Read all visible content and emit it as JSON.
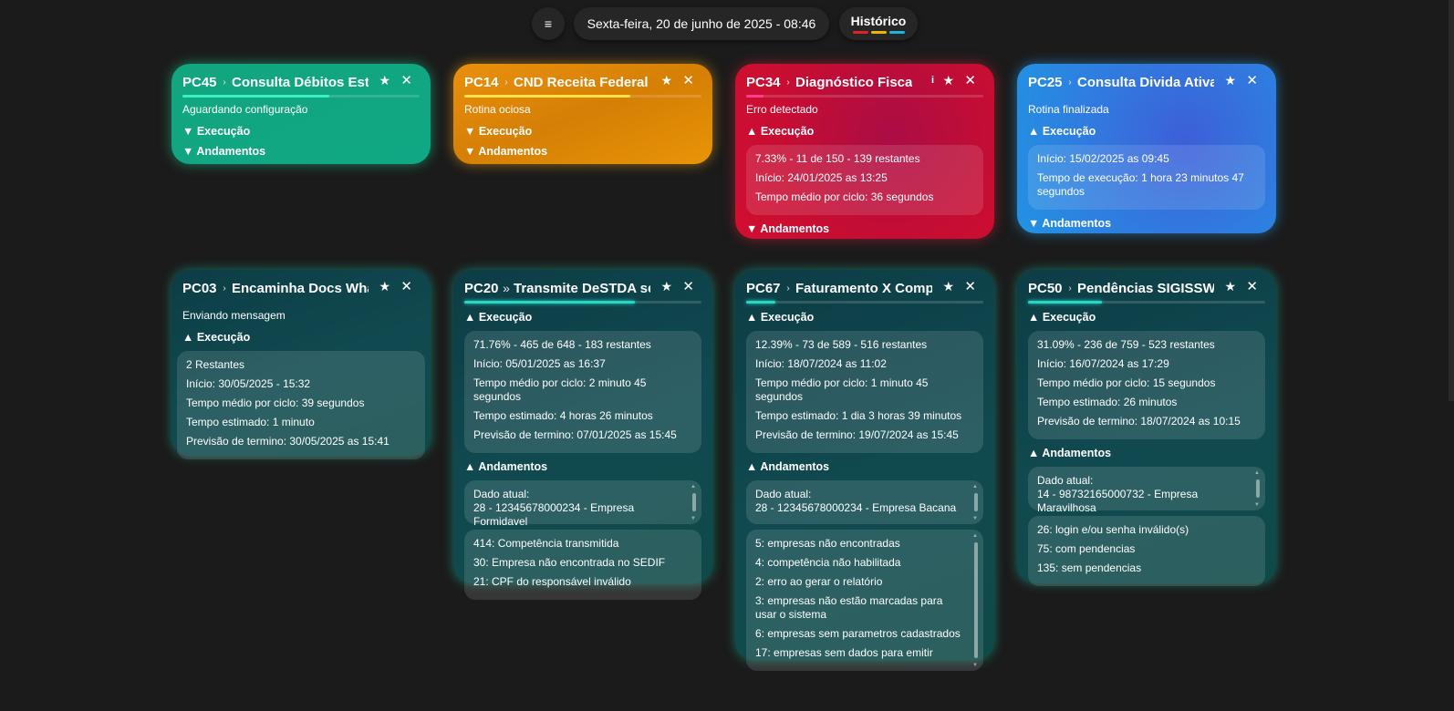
{
  "topbar": {
    "menu_icon": "hamburger-icon",
    "menu_glyph": "≡",
    "date": "Sexta-feira, 20 de junho de 2025 - 08:46",
    "history_label": "Histórico",
    "history_colors": [
      "#e02323",
      "#f0b400",
      "#19b8e0"
    ]
  },
  "cards": {
    "pc45": {
      "id": "PC45",
      "title": "Consulta Débitos Estaduais",
      "status": "Aguardando configuração",
      "exec_label": "▼ Execução",
      "and_label": "▼ Andamentos",
      "progress": 0.62,
      "color": "green"
    },
    "pc14": {
      "id": "PC14",
      "title": "CND Receita Federal CNPJ",
      "status": "Rotina ociosa",
      "exec_label": "▼ Execução",
      "and_label": "▼ Andamentos",
      "progress": 0.7,
      "color": "orange"
    },
    "pc34": {
      "id": "PC34",
      "title": "Diagnóstico Fiscal",
      "status": "Erro detectado",
      "exec_label": "▲ Execução",
      "and_label": "▼ Andamentos",
      "progress": 0.0733,
      "exec_lines": [
        "7.33% - 11 de 150 - 139 restantes",
        "Início: 24/01/2025 as 13:25",
        "Tempo médio por ciclo: 36 segundos"
      ],
      "color": "red"
    },
    "pc25": {
      "id": "PC25",
      "title": "Consulta Divida Ativa",
      "status": "Rotina finalizada",
      "exec_label": "▲ Execução",
      "and_label": "▼ Andamentos",
      "progress": 0,
      "exec_lines": [
        "Início: 15/02/2025 as 09:45",
        "Tempo de execução: 1 hora 23 minutos 47 segundos"
      ],
      "color": "blue"
    },
    "pc03": {
      "id": "PC03",
      "title": "Encaminha Docs WhatsApp",
      "status": "Enviando mensagem",
      "exec_label": "▲ Execução",
      "progress": 0,
      "exec_lines": [
        "2 Restantes",
        "Início: 30/05/2025 - 15:32",
        "Tempo médio por ciclo: 39 segundos",
        "Tempo estimado: 1 minuto",
        "Previsão de termino: 30/05/2025 as 15:41"
      ],
      "color": "teal"
    },
    "pc20": {
      "id": "PC20",
      "title": "Transmite DeSTDA sefaz",
      "status": "",
      "exec_label": "▲ Execução",
      "and_label": "▲ Andamentos",
      "progress": 0.7176,
      "exec_lines": [
        "71.76% - 465 de 648 - 183 restantes",
        "Início: 05/01/2025 as 16:37",
        "Tempo médio por ciclo: 2 minuto 45 segundos",
        "Tempo estimado: 4 horas 26 minutos",
        "Previsão de termino: 07/01/2025 as 15:45"
      ],
      "dado_label": "Dado atual:",
      "dado_value": "28 - 12345678000234 - Empresa Formidavel",
      "and_lines": [
        "414: Competência transmitida",
        "30: Empresa não encontrada no SEDIF",
        "21: CPF do responsável inválido"
      ],
      "color": "teal"
    },
    "pc67": {
      "id": "PC67",
      "title": "Faturamento X Compras",
      "status": "",
      "exec_label": "▲ Execução",
      "and_label": "▲ Andamentos",
      "progress": 0.1239,
      "exec_lines": [
        "12.39% - 73 de 589 - 516 restantes",
        "Início: 18/07/2024 as 11:02",
        "Tempo médio por ciclo: 1 minuto 45 segundos",
        "Tempo estimado: 1 dia 3 horas 39 minutos",
        "Previsão de termino: 19/07/2024 as 15:45"
      ],
      "dado_label": "Dado atual:",
      "dado_value": "28 - 12345678000234 - Empresa Bacana",
      "and_lines": [
        "5: empresas não encontradas",
        "4: competência não habilitada",
        "2: erro ao gerar o relatório",
        "3: empresas não estão marcadas para usar o sistema",
        "6: empresas sem parametros cadastrados",
        "17: empresas sem dados para emitir"
      ],
      "color": "teal"
    },
    "pc50": {
      "id": "PC50",
      "title": "Pendências SIGISSWEB",
      "status": "",
      "exec_label": "▲ Execução",
      "and_label": "▲ Andamentos",
      "progress": 0.3109,
      "exec_lines": [
        "31.09% - 236 de 759 - 523 restantes",
        "Início: 16/07/2024 as 17:29",
        "Tempo médio por ciclo: 15 segundos",
        "Tempo estimado: 26 minutos",
        "Previsão de termino: 18/07/2024 as 10:15"
      ],
      "dado_label": "Dado atual:",
      "dado_value": "14 - 98732165000732 - Empresa Maravilhosa",
      "and_lines": [
        "26: login e/ou senha inválido(s)",
        "75: com pendencias",
        "135: sem pendencias"
      ],
      "color": "teal"
    }
  },
  "icons": {
    "arrow": "chevron-right-icon",
    "double_arrow": "double-chevron-right-icon",
    "star": "star-icon",
    "close": "close-icon",
    "info": "info-icon"
  },
  "glyphs": {
    "arrow": "›",
    "double_arrow": "»",
    "star": "★",
    "close": "✕",
    "info": "i"
  }
}
